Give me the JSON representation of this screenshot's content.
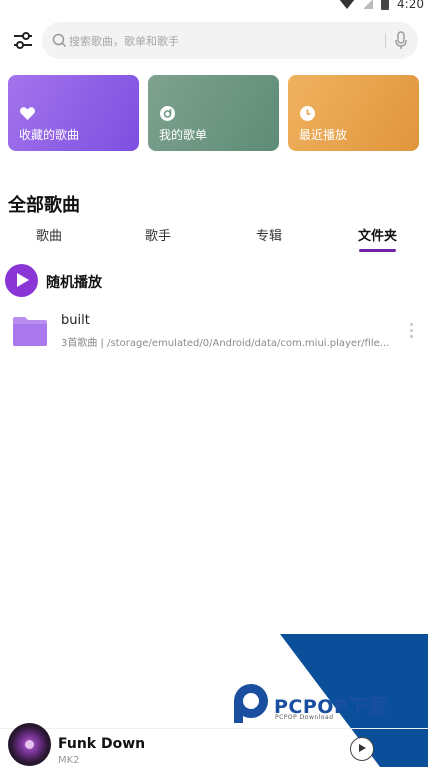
{
  "statusbar": {
    "time": "4:20"
  },
  "search": {
    "placeholder": "搜索歌曲，歌单和歌手"
  },
  "cards": {
    "favorites": "收藏的歌曲",
    "my_playlists": "我的歌单",
    "recent": "最近播放"
  },
  "library": {
    "title": "全部歌曲",
    "tabs": [
      "歌曲",
      "歌手",
      "专辑",
      "文件夹"
    ],
    "active_tab": "文件夹"
  },
  "shuffle": {
    "label": "随机播放"
  },
  "folders": [
    {
      "name": "built",
      "description": "3首歌曲 | /storage/emulated/0/Android/data/com.miui.player/file..."
    }
  ],
  "watermark": {
    "brand": "PCPOP下载",
    "sub": "PCPOP Download"
  },
  "now_playing": {
    "title": "Funk Down",
    "artist": "MK2"
  },
  "colors": {
    "accent": "#8a35d6",
    "tab_underline": "#6f22a8",
    "favorites_card": "#8d5ee6",
    "playlists_card": "#6e9884",
    "recent_card": "#e8a44d"
  }
}
